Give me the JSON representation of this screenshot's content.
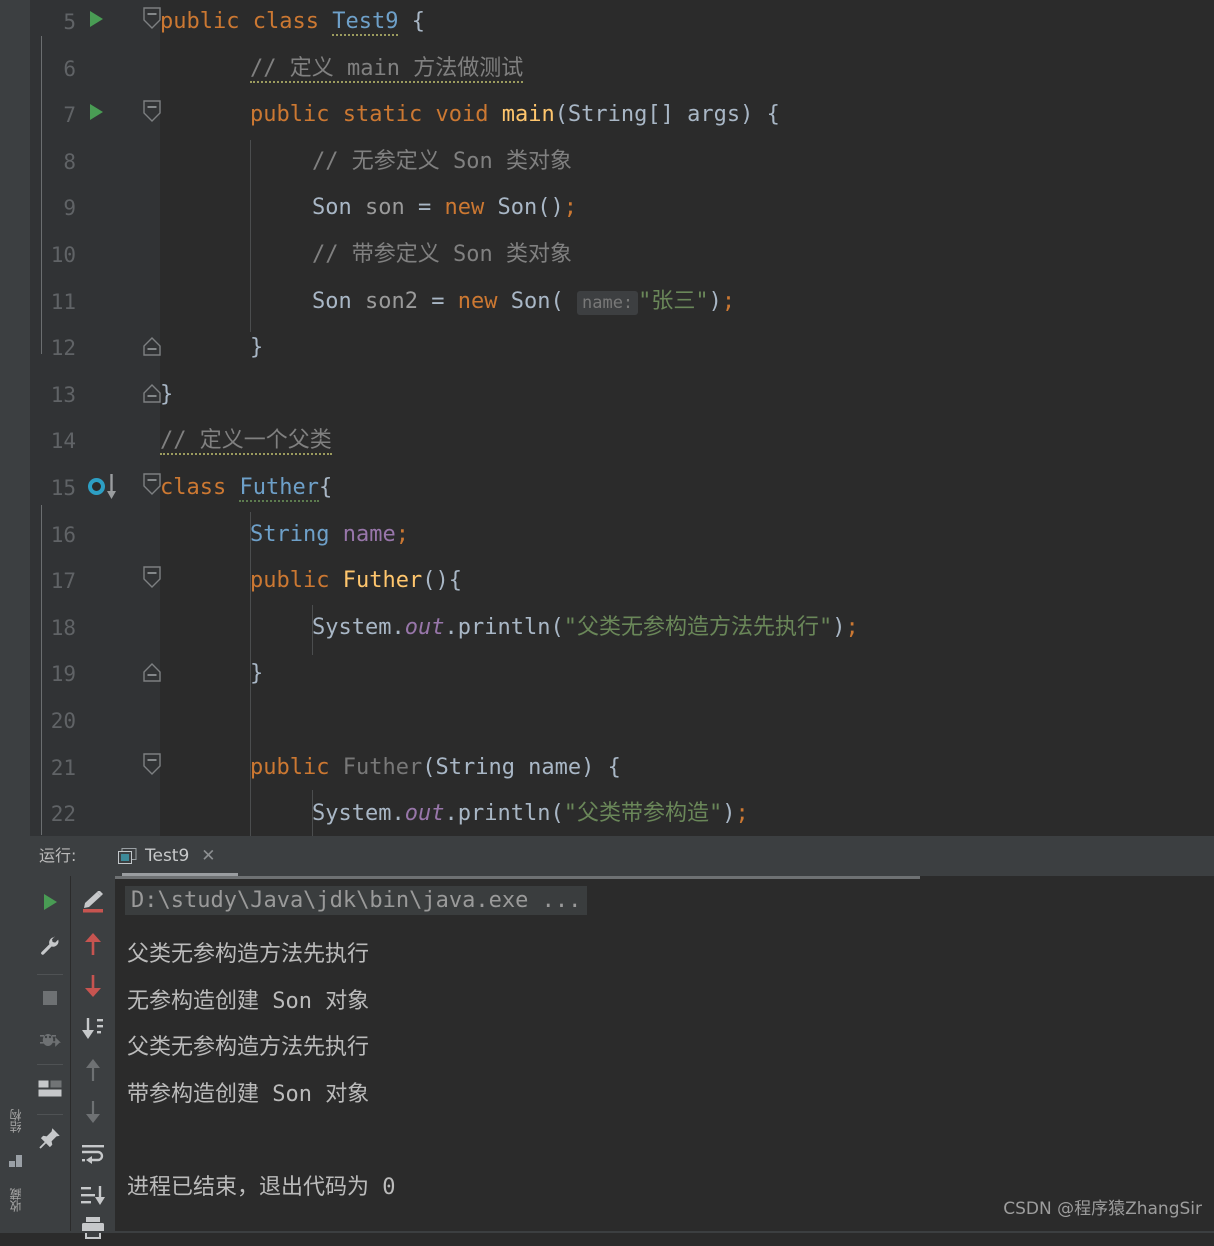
{
  "window": {
    "theme_bg": "#2b2b2b",
    "panel_bg": "#3c3f41",
    "gutter_bg": "#313335"
  },
  "left_strip": {
    "structure_label": "结构",
    "favorites_label": "收藏"
  },
  "editor": {
    "first_line_number": 5,
    "lines": [
      {
        "number": "5",
        "gutter_icon": "run-gutter-icon",
        "fold": "fold-start",
        "indent": 0,
        "tokens": [
          {
            "t": "public",
            "c": "kw"
          },
          {
            "t": " ",
            "c": "plain"
          },
          {
            "t": "class",
            "c": "kw"
          },
          {
            "t": " ",
            "c": "plain"
          },
          {
            "t": "Test9",
            "c": "cls2 squig"
          },
          {
            "t": " {",
            "c": "plain"
          }
        ]
      },
      {
        "number": "6",
        "gutter_icon": "",
        "fold": "",
        "indent": 1,
        "tokens": [
          {
            "t": "// 定义 main 方法做测试",
            "c": "cmt squig"
          }
        ]
      },
      {
        "number": "7",
        "gutter_icon": "run-gutter-icon",
        "fold": "fold-start",
        "indent": 1,
        "tokens": [
          {
            "t": "public",
            "c": "kw"
          },
          {
            "t": " ",
            "c": "plain"
          },
          {
            "t": "static",
            "c": "kw"
          },
          {
            "t": " ",
            "c": "plain"
          },
          {
            "t": "void",
            "c": "kw"
          },
          {
            "t": " ",
            "c": "plain"
          },
          {
            "t": "main",
            "c": "meth"
          },
          {
            "t": "(String[] args) {",
            "c": "plain"
          }
        ]
      },
      {
        "number": "8",
        "gutter_icon": "",
        "fold": "",
        "indent": 2,
        "tokens": [
          {
            "t": "// 无参定义 Son 类对象",
            "c": "cmt"
          }
        ]
      },
      {
        "number": "9",
        "gutter_icon": "",
        "fold": "",
        "indent": 2,
        "tokens": [
          {
            "t": "Son",
            "c": "cls"
          },
          {
            "t": " ",
            "c": "plain"
          },
          {
            "t": "son",
            "c": "id-gray"
          },
          {
            "t": " = ",
            "c": "plain"
          },
          {
            "t": "new",
            "c": "kw"
          },
          {
            "t": " ",
            "c": "plain"
          },
          {
            "t": "Son",
            "c": "cls"
          },
          {
            "t": "()",
            "c": "plain"
          },
          {
            "t": ";",
            "c": "kw"
          }
        ]
      },
      {
        "number": "10",
        "gutter_icon": "",
        "fold": "",
        "indent": 2,
        "tokens": [
          {
            "t": "// 带参定义 Son 类对象",
            "c": "cmt"
          }
        ]
      },
      {
        "number": "11",
        "gutter_icon": "",
        "fold": "",
        "indent": 2,
        "param_hint": "name:",
        "tokens": [
          {
            "t": "Son",
            "c": "cls"
          },
          {
            "t": " ",
            "c": "plain"
          },
          {
            "t": "son2",
            "c": "id-gray"
          },
          {
            "t": " = ",
            "c": "plain"
          },
          {
            "t": "new",
            "c": "kw"
          },
          {
            "t": " ",
            "c": "plain"
          },
          {
            "t": "Son",
            "c": "cls"
          },
          {
            "t": "( ",
            "c": "plain"
          },
          {
            "t": "HINT",
            "c": "hint"
          },
          {
            "t": "\"张三\"",
            "c": "str"
          },
          {
            "t": ")",
            "c": "plain"
          },
          {
            "t": ";",
            "c": "kw"
          }
        ]
      },
      {
        "number": "12",
        "gutter_icon": "",
        "fold": "fold-end",
        "indent": 1,
        "tokens": [
          {
            "t": "}",
            "c": "plain"
          }
        ]
      },
      {
        "number": "13",
        "gutter_icon": "",
        "fold": "fold-end",
        "indent": 0,
        "tokens": [
          {
            "t": "}",
            "c": "plain"
          }
        ]
      },
      {
        "number": "14",
        "gutter_icon": "",
        "fold": "",
        "indent": 0,
        "tokens": [
          {
            "t": "// 定义一个父类",
            "c": "cmt squig"
          }
        ]
      },
      {
        "number": "15",
        "gutter_icon": "overridden-marker-icon",
        "fold": "fold-start",
        "indent": 0,
        "tokens": [
          {
            "t": "class",
            "c": "kw"
          },
          {
            "t": " ",
            "c": "plain"
          },
          {
            "t": "Futher",
            "c": "cls2 squig-g"
          },
          {
            "t": "{",
            "c": "plain"
          }
        ]
      },
      {
        "number": "16",
        "gutter_icon": "",
        "fold": "",
        "indent": 1,
        "tokens": [
          {
            "t": "String",
            "c": "cls2"
          },
          {
            "t": " ",
            "c": "plain"
          },
          {
            "t": "name",
            "c": "fld"
          },
          {
            "t": ";",
            "c": "kw"
          }
        ]
      },
      {
        "number": "17",
        "gutter_icon": "",
        "fold": "fold-start",
        "indent": 1,
        "tokens": [
          {
            "t": "public",
            "c": "kw"
          },
          {
            "t": " ",
            "c": "plain"
          },
          {
            "t": "Futher",
            "c": "meth"
          },
          {
            "t": "(){",
            "c": "plain"
          }
        ]
      },
      {
        "number": "18",
        "gutter_icon": "",
        "fold": "",
        "indent": 2,
        "tokens": [
          {
            "t": "System",
            "c": "plain"
          },
          {
            "t": ".",
            "c": "plain"
          },
          {
            "t": "out",
            "c": "fld-italic"
          },
          {
            "t": ".println(",
            "c": "plain"
          },
          {
            "t": "\"父类无参构造方法先执行\"",
            "c": "str"
          },
          {
            "t": ")",
            "c": "plain"
          },
          {
            "t": ";",
            "c": "kw"
          }
        ]
      },
      {
        "number": "19",
        "gutter_icon": "",
        "fold": "fold-end",
        "indent": 1,
        "tokens": [
          {
            "t": "}",
            "c": "plain"
          }
        ]
      },
      {
        "number": "20",
        "gutter_icon": "",
        "fold": "",
        "indent": 0,
        "tokens": []
      },
      {
        "number": "21",
        "gutter_icon": "",
        "fold": "fold-start",
        "indent": 1,
        "tokens": [
          {
            "t": "public",
            "c": "kw"
          },
          {
            "t": " ",
            "c": "plain"
          },
          {
            "t": "Futher",
            "c": "dim"
          },
          {
            "t": "(String name) {",
            "c": "plain"
          }
        ]
      },
      {
        "number": "22",
        "gutter_icon": "",
        "fold": "",
        "indent": 2,
        "tokens": [
          {
            "t": "System",
            "c": "plain"
          },
          {
            "t": ".",
            "c": "plain"
          },
          {
            "t": "out",
            "c": "fld-italic"
          },
          {
            "t": ".println(",
            "c": "plain"
          },
          {
            "t": "\"父类带参构造\"",
            "c": "str"
          },
          {
            "t": ")",
            "c": "plain"
          },
          {
            "t": ";",
            "c": "kw"
          }
        ]
      }
    ]
  },
  "console": {
    "run_label": "运行:",
    "tab_name": "Test9",
    "tab_close": "✕",
    "left_toolbar": [
      {
        "name": "rerun-button",
        "icon": "green-play-icon"
      },
      {
        "name": "settings-button",
        "icon": "wrench-icon"
      },
      {
        "name": "stop-button",
        "icon": "stop-square-icon"
      },
      {
        "name": "attach-debugger-button",
        "icon": "bug-attach-icon"
      },
      {
        "name": "layout-button",
        "icon": "layout-icon"
      },
      {
        "name": "pin-tab-button",
        "icon": "pin-icon"
      }
    ],
    "right_toolbar": [
      {
        "name": "soft-wrap-button",
        "icon": "pencil-underline-icon"
      },
      {
        "name": "prev-error-button",
        "icon": "red-up-arrow-icon"
      },
      {
        "name": "next-error-button",
        "icon": "red-down-arrow-icon"
      },
      {
        "name": "scroll-to-end-button",
        "icon": "scroll-end-icon"
      },
      {
        "name": "up-button",
        "icon": "gray-up-arrow-icon"
      },
      {
        "name": "down-button",
        "icon": "gray-down-arrow-icon"
      },
      {
        "name": "use-soft-wraps-button",
        "icon": "wrap-lines-icon"
      },
      {
        "name": "scroll-to-stacktrace-end-button",
        "icon": "scroll-stack-icon"
      },
      {
        "name": "print-button",
        "icon": "printer-icon"
      }
    ],
    "command_line": "D:\\study\\Java\\jdk\\bin\\java.exe ...",
    "output_lines": [
      "父类无参构造方法先执行",
      "无参构造创建 Son 对象",
      "父类无参构造方法先执行",
      "带参构造创建 Son 对象",
      "",
      "进程已结束，退出代码为 0"
    ]
  },
  "watermark": {
    "text": "CSDN @程序猿ZhangSir"
  }
}
